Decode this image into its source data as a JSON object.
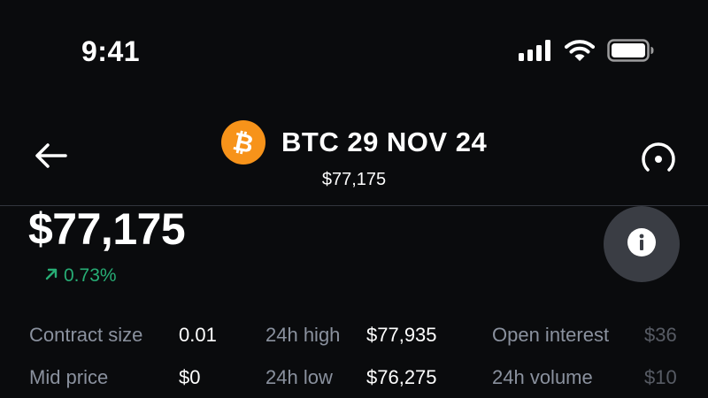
{
  "status_bar": {
    "time": "9:41",
    "icons": [
      "cellular-signal-icon",
      "wifi-icon",
      "battery-icon"
    ]
  },
  "header": {
    "back_icon": "arrow-left-icon",
    "coin_icon": "bitcoin-icon",
    "title": "BTC 29 NOV 24",
    "subtitle_price": "$77,175",
    "chart_icon": "gauge-icon"
  },
  "price": {
    "value": "$77,175",
    "change": "0.73%",
    "change_icon": "arrow-up-right-icon"
  },
  "info_icon": "info-icon",
  "stats": {
    "contract_size_label": "Contract size",
    "contract_size_value": "0.01",
    "mid_price_label": "Mid price",
    "mid_price_value": "$0",
    "high_24h_label": "24h high",
    "high_24h_value": "$77,935",
    "low_24h_label": "24h low",
    "low_24h_value": "$76,275",
    "open_interest_label": "Open interest",
    "open_interest_value": "$36",
    "volume_24h_label": "24h volume",
    "volume_24h_value": "$10"
  },
  "colors": {
    "background": "#0a0b0d",
    "positive": "#27ad75",
    "muted": "#8a919e",
    "bitcoin_orange": "#f7931a",
    "info_button": "#3a3d44"
  }
}
